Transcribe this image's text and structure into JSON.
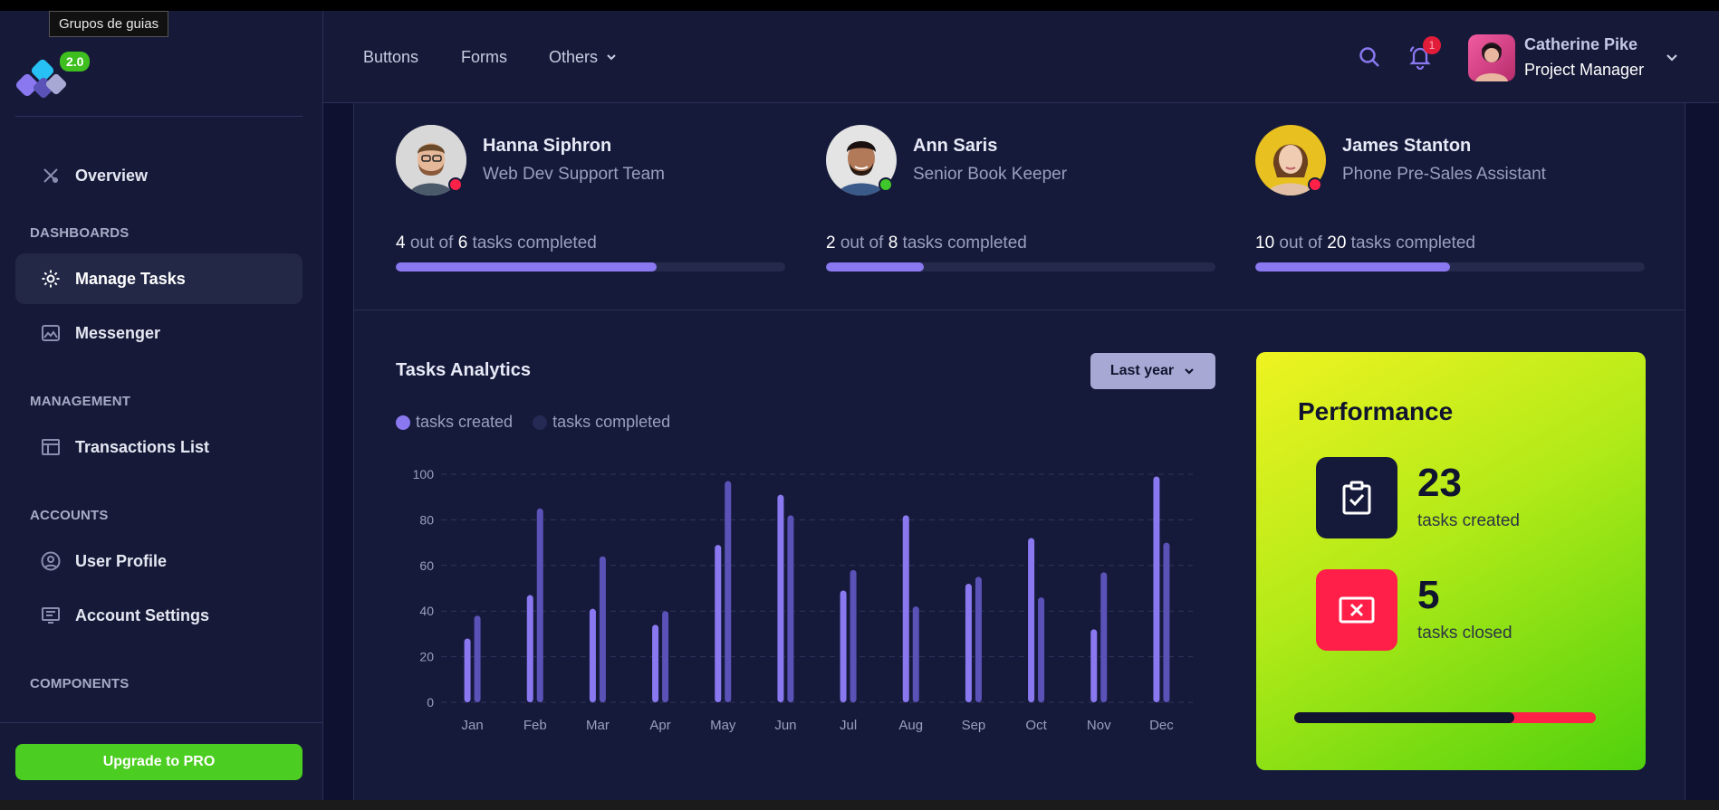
{
  "tooltip": "Grupos de guias",
  "version": "2.0",
  "sidebar": {
    "overview": "Overview",
    "sections": {
      "dashboards": "DASHBOARDS",
      "management": "MANAGEMENT",
      "accounts": "ACCOUNTS",
      "components": "COMPONENTS"
    },
    "items": {
      "manage_tasks": "Manage Tasks",
      "messenger": "Messenger",
      "transactions": "Transactions List",
      "user_profile": "User Profile",
      "account_settings": "Account Settings"
    },
    "upgrade": "Upgrade to PRO"
  },
  "header": {
    "nav": {
      "buttons": "Buttons",
      "forms": "Forms",
      "others": "Others"
    },
    "notifications_count": "1",
    "user": {
      "name": "Catherine Pike",
      "role": "Project Manager"
    }
  },
  "team": [
    {
      "name": "Hanna Siphron",
      "role": "Web Dev Support Team",
      "done": "4",
      "total": "6",
      "of_text": "out of",
      "suffix": "tasks completed",
      "status": "busy",
      "progress": 0.67
    },
    {
      "name": "Ann Saris",
      "role": "Senior Book Keeper",
      "done": "2",
      "total": "8",
      "of_text": "out of",
      "suffix": "tasks completed",
      "status": "online",
      "progress": 0.25
    },
    {
      "name": "James Stanton",
      "role": "Phone Pre-Sales Assistant",
      "done": "10",
      "total": "20",
      "of_text": "out of",
      "suffix": "tasks completed",
      "status": "busy",
      "progress": 0.5
    }
  ],
  "analytics": {
    "title": "Tasks Analytics",
    "range": "Last year",
    "legend": {
      "created": "tasks created",
      "completed": "tasks completed"
    }
  },
  "colors": {
    "created": "#8a78f0",
    "completed": "#5b52b8",
    "online": "#3fc62a",
    "busy": "#ff2148"
  },
  "chart_data": {
    "type": "bar",
    "categories": [
      "Jan",
      "Feb",
      "Mar",
      "Apr",
      "May",
      "Jun",
      "Jul",
      "Aug",
      "Sep",
      "Oct",
      "Nov",
      "Dec"
    ],
    "series": [
      {
        "name": "tasks created",
        "values": [
          28,
          47,
          41,
          34,
          69,
          91,
          49,
          82,
          52,
          72,
          32,
          99
        ]
      },
      {
        "name": "tasks completed",
        "values": [
          38,
          85,
          64,
          40,
          97,
          82,
          58,
          42,
          55,
          46,
          57,
          70
        ]
      }
    ],
    "yticks": [
      0,
      20,
      40,
      60,
      80,
      100
    ],
    "ylim": [
      0,
      100
    ],
    "grid": true
  },
  "performance": {
    "title": "Performance",
    "created_value": "23",
    "created_label": "tasks created",
    "closed_value": "5",
    "closed_label": "tasks closed",
    "progress": 0.73
  }
}
